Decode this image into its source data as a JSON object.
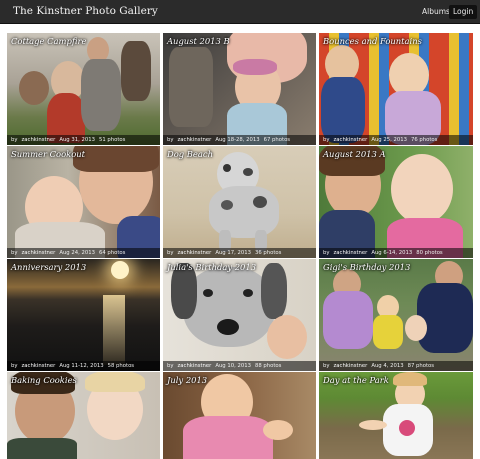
{
  "header": {
    "title": "The Kinstner Photo Gallery",
    "nav": {
      "albums": "Albums",
      "login": "Login"
    }
  },
  "albums": [
    {
      "title": "Cottage Campfire",
      "by": "by",
      "user": "zachkinstner",
      "date": "Aug 31, 2013",
      "count": "51 photos"
    },
    {
      "title": "August 2013 B",
      "by": "by",
      "user": "zachkinstner",
      "date": "Aug 18-28, 2013",
      "count": "67 photos"
    },
    {
      "title": "Bounces and Fountains",
      "by": "by",
      "user": "zachkinstner",
      "date": "Aug 25, 2013",
      "count": "76 photos"
    },
    {
      "title": "Summer Cookout",
      "by": "by",
      "user": "zachkinstner",
      "date": "Aug 24, 2013",
      "count": "64 photos"
    },
    {
      "title": "Dog Beach",
      "by": "by",
      "user": "zachkinstner",
      "date": "Aug 17, 2013",
      "count": "36 photos"
    },
    {
      "title": "August 2013 A",
      "by": "by",
      "user": "zachkinstner",
      "date": "Aug 6-14, 2013",
      "count": "80 photos"
    },
    {
      "title": "Anniversary 2013",
      "by": "by",
      "user": "zachkinstner",
      "date": "Aug 11-12, 2013",
      "count": "58 photos"
    },
    {
      "title": "Julia's Birthday 2013",
      "by": "by",
      "user": "zachkinstner",
      "date": "Aug 10, 2013",
      "count": "88 photos"
    },
    {
      "title": "Gigi's Birthday 2013",
      "by": "by",
      "user": "zachkinstner",
      "date": "Aug 4, 2013",
      "count": "87 photos"
    },
    {
      "title": "Baking Cookies",
      "by": "",
      "user": "",
      "date": "",
      "count": ""
    },
    {
      "title": "July 2013",
      "by": "",
      "user": "",
      "date": "",
      "count": ""
    },
    {
      "title": "Day at the Park",
      "by": "",
      "user": "",
      "date": "",
      "count": ""
    }
  ]
}
